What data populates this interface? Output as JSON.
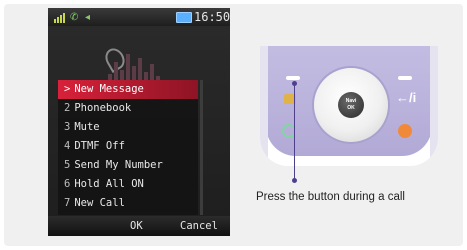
{
  "phone": {
    "status": {
      "time": "16:50"
    },
    "menu": {
      "items": [
        {
          "num": ">",
          "label": "New Message",
          "selected": true
        },
        {
          "num": "2",
          "label": "Phonebook"
        },
        {
          "num": "3",
          "label": "Mute"
        },
        {
          "num": "4",
          "label": "DTMF Off"
        },
        {
          "num": "5",
          "label": "Send My Number"
        },
        {
          "num": "6",
          "label": "Hold All ON"
        },
        {
          "num": "7",
          "label": "New Call"
        }
      ]
    },
    "softkeys": {
      "left": "OK",
      "right": "Cancel"
    }
  },
  "keypad": {
    "center_key_text": [
      "Navi",
      "OK"
    ],
    "back_key": "←/i"
  },
  "caption": "Press the button during a call",
  "colors": {
    "selection": "#d8213a",
    "keypad": "#b9b1dc",
    "pointer": "#4e3f8a"
  }
}
